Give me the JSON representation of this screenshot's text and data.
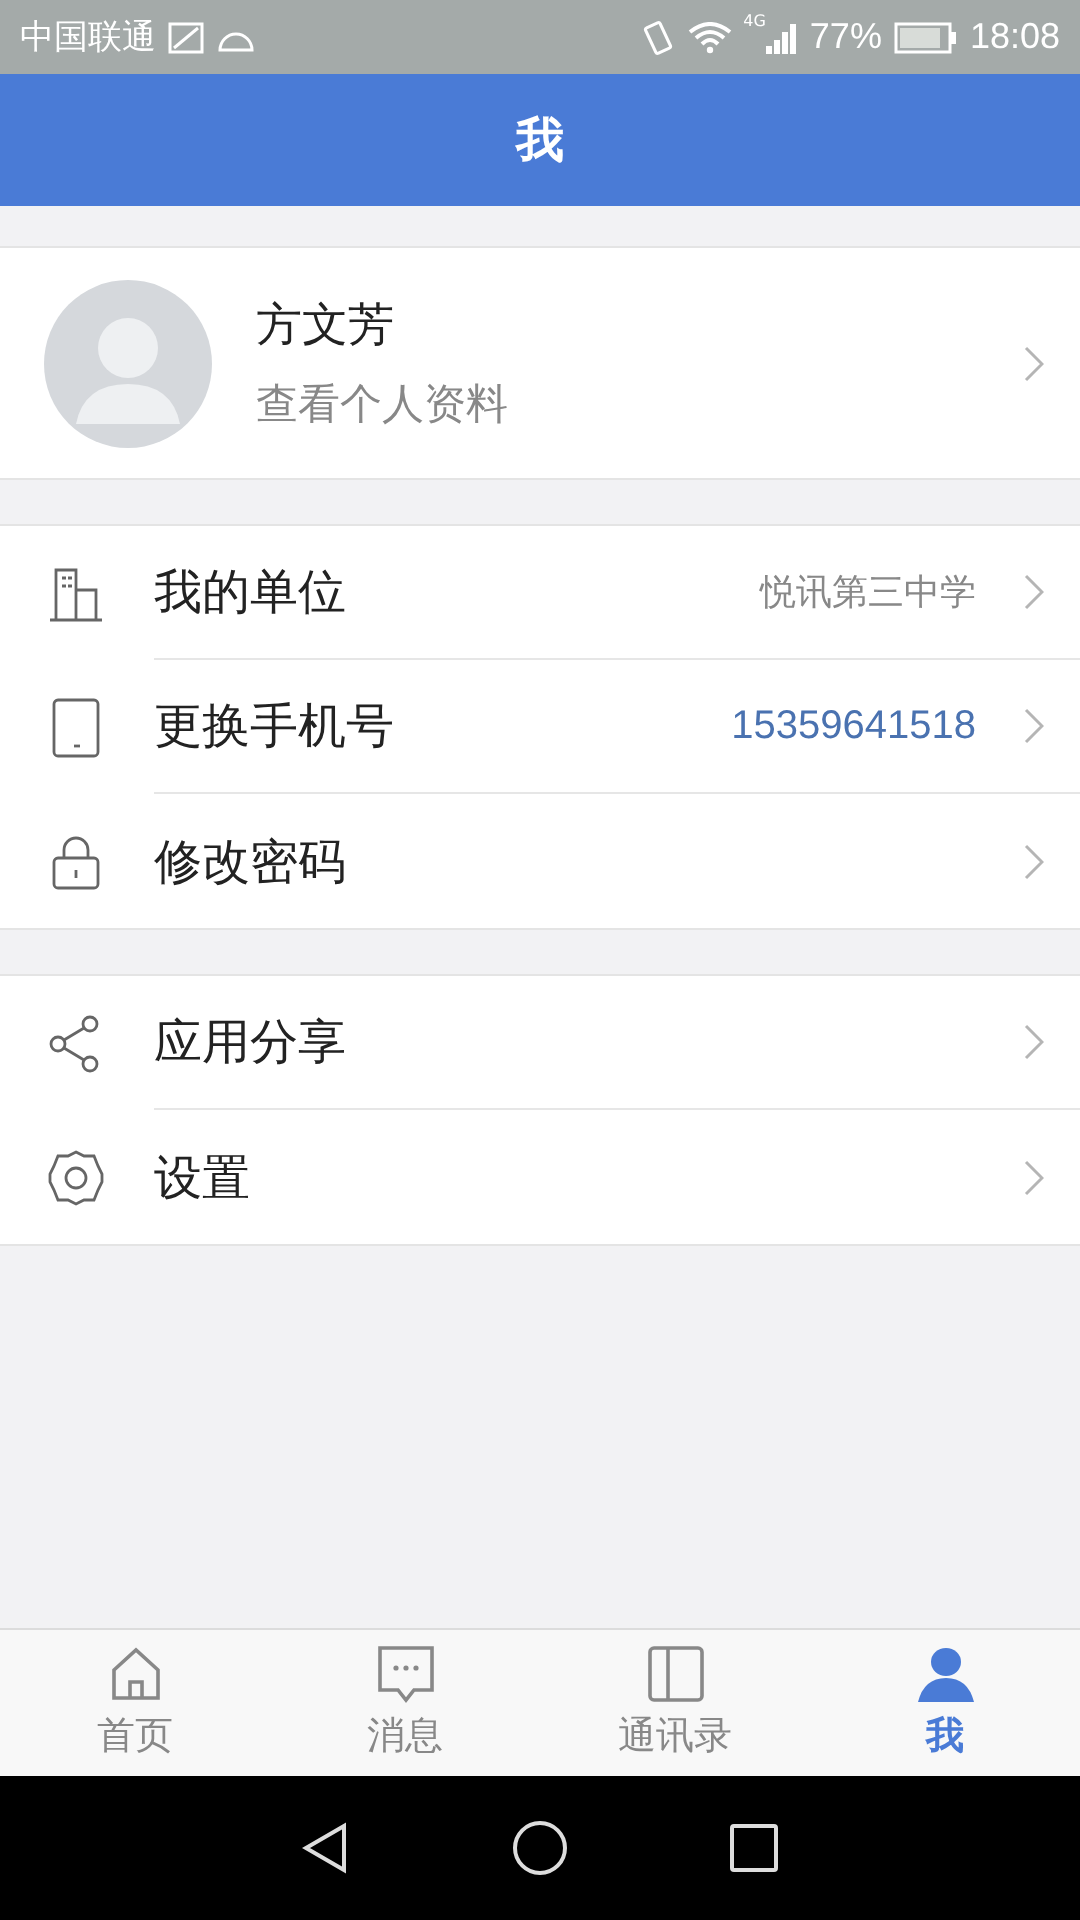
{
  "status_bar": {
    "carrier": "中国联通",
    "network": "4G",
    "battery": "77%",
    "time": "18:08"
  },
  "header": {
    "title": "我"
  },
  "profile": {
    "name": "方文芳",
    "subtitle": "查看个人资料"
  },
  "groups": [
    {
      "items": [
        {
          "label": "我的单位",
          "value": {
            "text": "悦讯第三中学",
            "kind": "plain"
          }
        },
        {
          "label": "更换手机号",
          "value": {
            "text": "15359641518",
            "kind": "link"
          }
        },
        {
          "label": "修改密码"
        }
      ]
    },
    {
      "items": [
        {
          "label": "应用分享"
        },
        {
          "label": "设置"
        }
      ]
    }
  ],
  "tabs": [
    {
      "label": "首页",
      "selected": false
    },
    {
      "label": "消息",
      "selected": false
    },
    {
      "label": "通讯录",
      "selected": false
    },
    {
      "label": "我",
      "selected": true
    }
  ]
}
